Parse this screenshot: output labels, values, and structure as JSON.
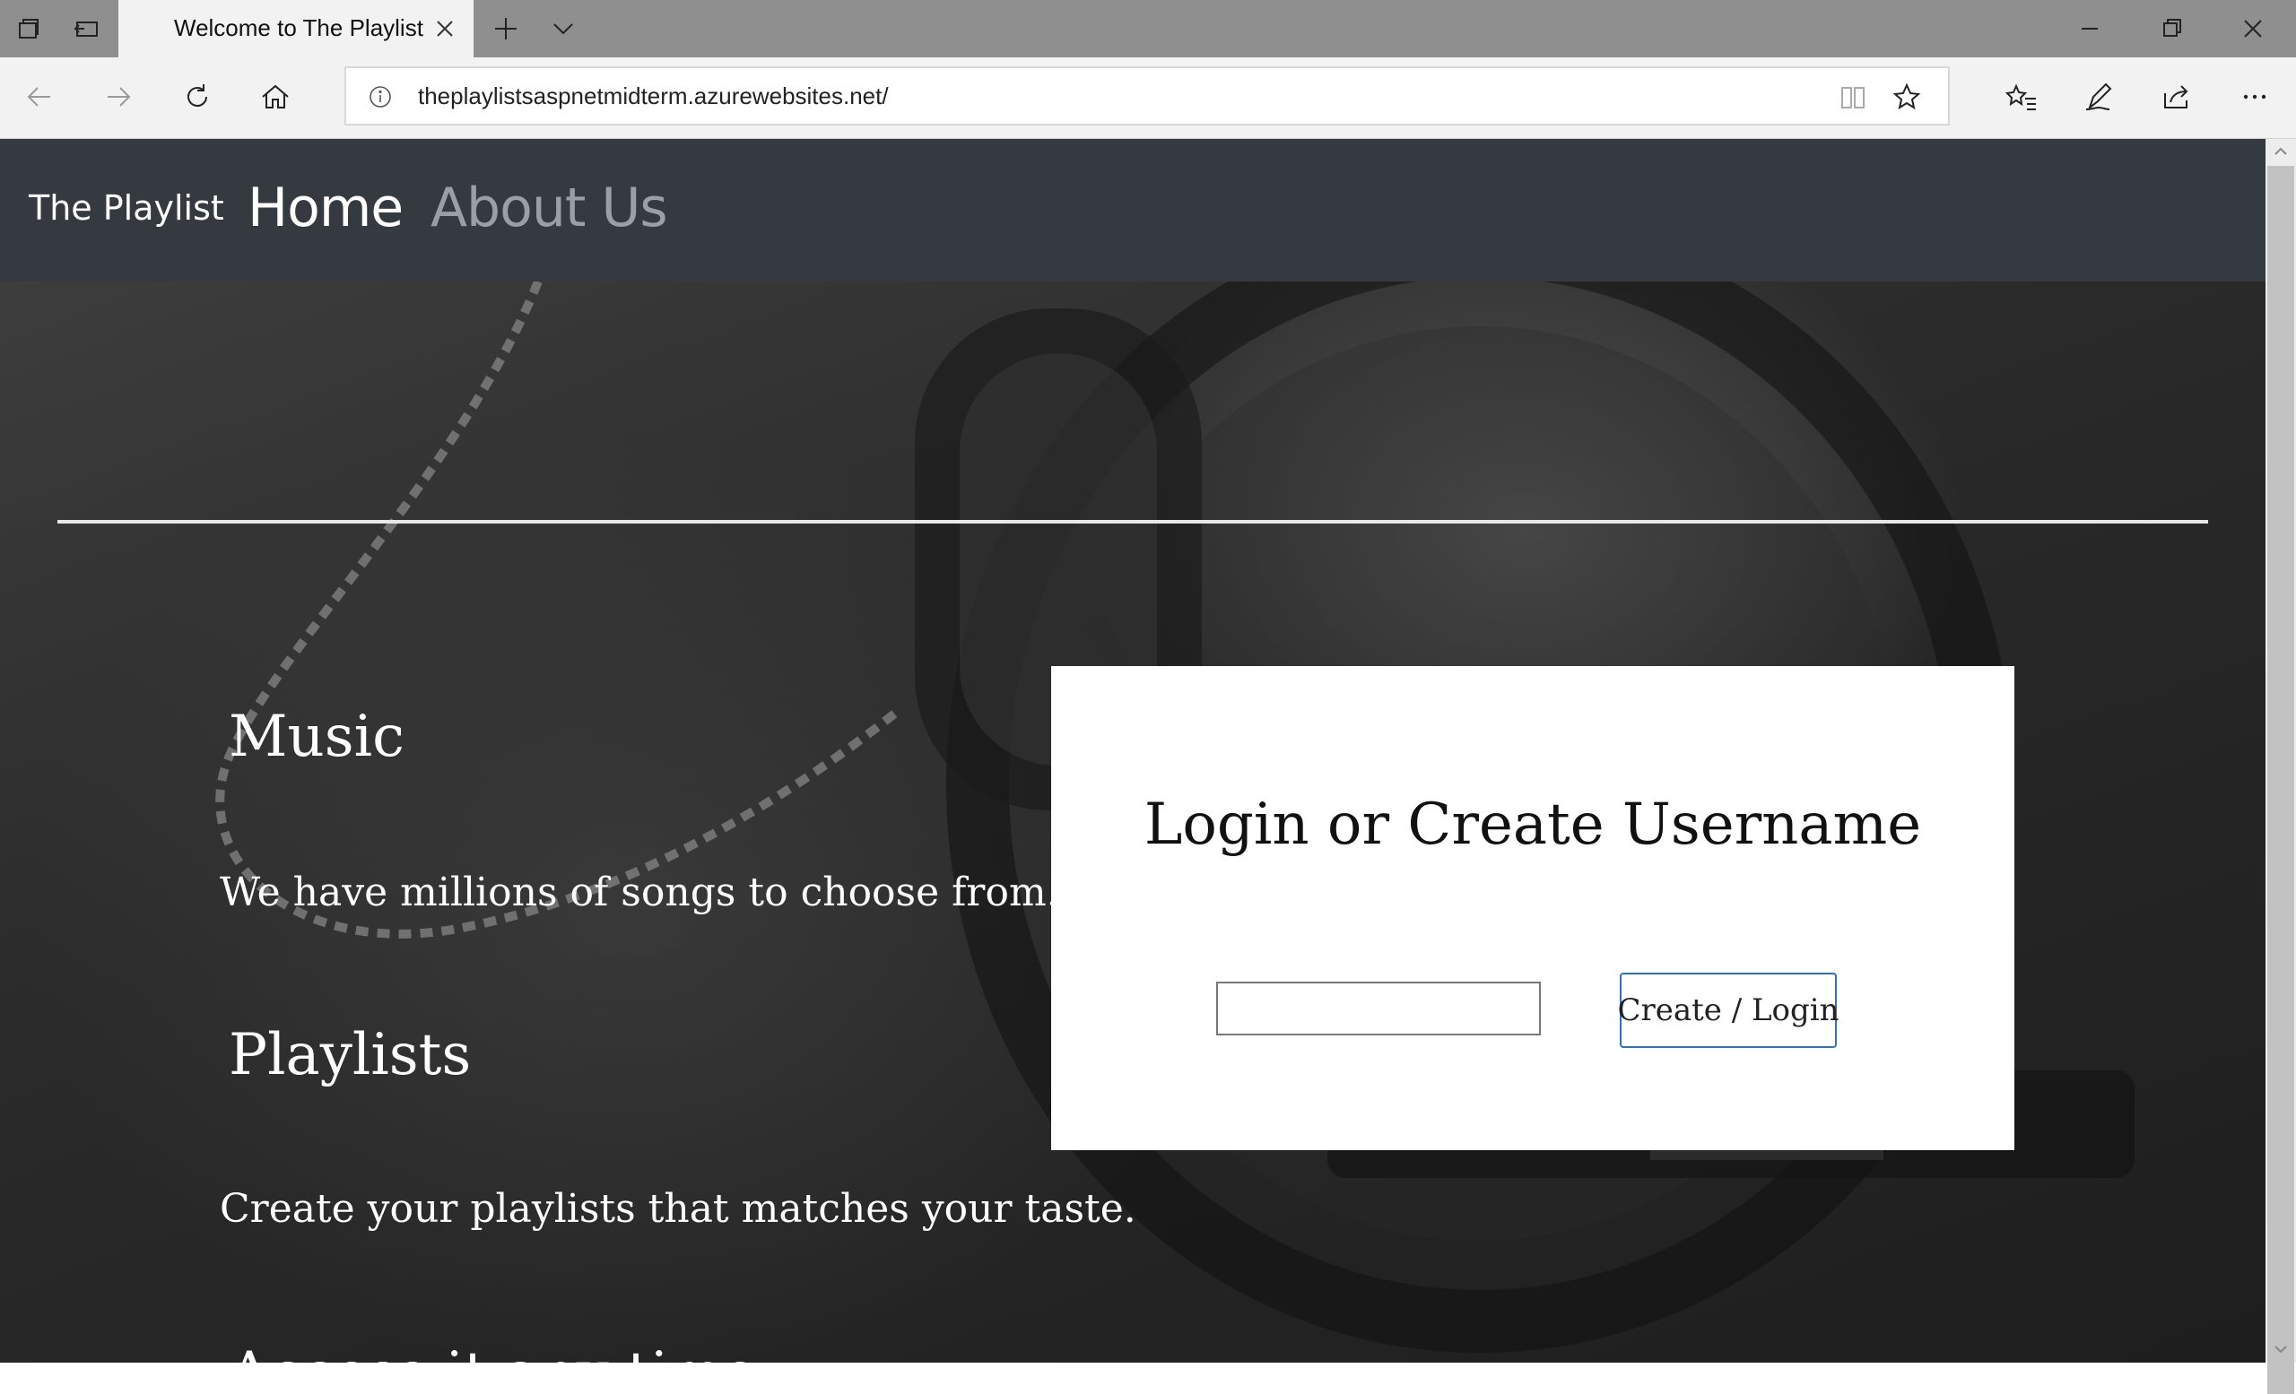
{
  "browser": {
    "tab_title": "Welcome to The Playlist",
    "url": "theplaylistsaspnetmidterm.azurewebsites.net/"
  },
  "site": {
    "brand": "The Playlist",
    "nav": {
      "home": "Home",
      "about": "About Us"
    }
  },
  "hero": {
    "sections": [
      {
        "heading": "Music",
        "text": "We have millions of songs to choose from."
      },
      {
        "heading": "Playlists",
        "text": "Create your playlists that matches your taste."
      },
      {
        "heading": "Access it any time"
      }
    ]
  },
  "login": {
    "title": "Login or Create Username",
    "username_value": "",
    "button_label": "Create / Login"
  },
  "icons": {
    "tab_actions": [
      "tab-preview-icon",
      "set-aside-tabs-icon"
    ],
    "strip": [
      "new-tab-icon",
      "tab-list-chevron-icon"
    ],
    "window": [
      "minimize-icon",
      "restore-icon",
      "close-window-icon"
    ],
    "nav": [
      "back-icon",
      "forward-icon",
      "refresh-icon",
      "home-icon"
    ],
    "address": [
      "site-info-icon",
      "reading-view-icon",
      "favorite-star-icon"
    ],
    "toolbar": [
      "favorites-hub-icon",
      "web-note-pen-icon",
      "share-icon",
      "more-ellipsis-icon"
    ]
  },
  "colors": {
    "navbar_bg": "#343a40",
    "nav_active": "#ffffff",
    "nav_inactive": "#9a9fa5",
    "button_border": "#2f72c4"
  }
}
